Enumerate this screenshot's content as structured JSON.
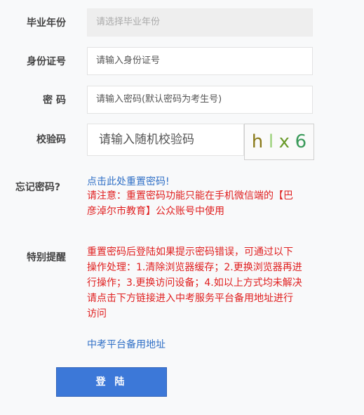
{
  "form": {
    "grad_year": {
      "label": "毕业年份",
      "placeholder": "请选择毕业年份"
    },
    "id_number": {
      "label": "身份证号",
      "placeholder": "请输入身份证号"
    },
    "password": {
      "label": "密 码",
      "placeholder": "请输入密码(默认密码为考生号)"
    },
    "captcha": {
      "label": "校验码",
      "placeholder": "请输入随机校验码",
      "chars": [
        "h",
        "l",
        "x",
        "6"
      ],
      "colors": [
        "#8a7a1a",
        "#9bd07a",
        "#6a9a2a",
        "#3a9a5a"
      ]
    }
  },
  "forgot": {
    "label": "忘记密码?",
    "reset_link": "点击此处重置密码!",
    "notice_line1": "请注意：重置密码功能只能在手机微信端的【巴",
    "notice_line2": "彦淖尔市教育】公众账号中使用"
  },
  "special": {
    "label": "特别提醒",
    "lines": [
      "重置密码后登陆如果提示密码错误，可通过以下",
      "操作处理：1.清除浏览器缓存；2.更换浏览器再进",
      "行操作；3.更换访问设备；4.如以上方式均未解决",
      "请点击下方链接进入中考服务平台备用地址进行",
      "访问"
    ],
    "backup_link": "中考平台备用地址"
  },
  "login_button": "登 陆",
  "colors": {
    "accent": "#3c78d8",
    "link": "#2f6fc6",
    "warning": "#e02020"
  }
}
